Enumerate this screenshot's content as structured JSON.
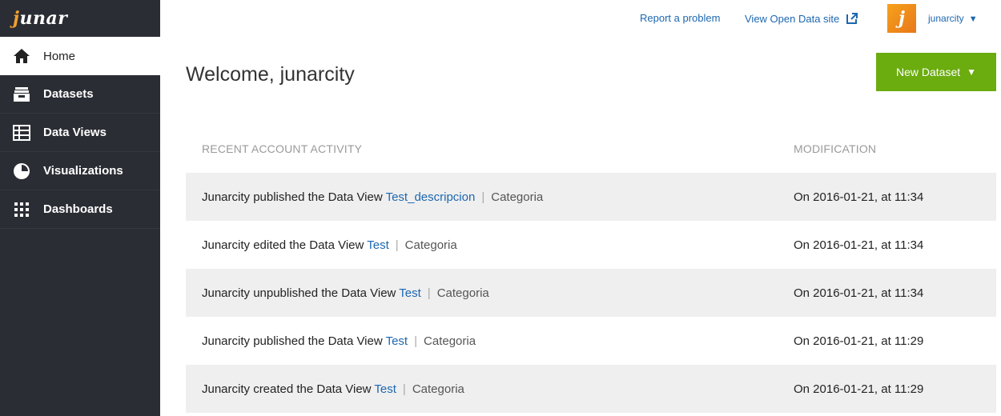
{
  "logo": {
    "text_j": "j",
    "text_rest": "unar"
  },
  "nav": [
    {
      "label": "Home",
      "icon": "home-icon"
    },
    {
      "label": "Datasets",
      "icon": "datasets-icon"
    },
    {
      "label": "Data Views",
      "icon": "data-views-icon"
    },
    {
      "label": "Visualizations",
      "icon": "visualizations-icon"
    },
    {
      "label": "Dashboards",
      "icon": "dashboards-icon"
    }
  ],
  "topbar": {
    "report_problem": "Report a problem",
    "view_site": "View Open Data site",
    "avatar_letter": "j",
    "username": "junarcity",
    "caret": "▼"
  },
  "main": {
    "title": "Welcome, junarcity",
    "new_dataset": "New Dataset",
    "new_dataset_caret": "▼"
  },
  "activity": {
    "header_activity": "RECENT ACCOUNT ACTIVITY",
    "header_modification": "MODIFICATION",
    "separator": "|",
    "rows": [
      {
        "text": "Junarcity published the Data View ",
        "link": "Test_descripcion",
        "category": "Categoria",
        "modified": "On 2016-01-21, at 11:34"
      },
      {
        "text": "Junarcity edited the Data View ",
        "link": "Test",
        "category": "Categoria",
        "modified": "On 2016-01-21, at 11:34"
      },
      {
        "text": "Junarcity unpublished the Data View ",
        "link": "Test",
        "category": "Categoria",
        "modified": "On 2016-01-21, at 11:34"
      },
      {
        "text": "Junarcity published the Data View ",
        "link": "Test",
        "category": "Categoria",
        "modified": "On 2016-01-21, at 11:29"
      },
      {
        "text": "Junarcity created the Data View ",
        "link": "Test",
        "category": "Categoria",
        "modified": "On 2016-01-21, at 11:29"
      }
    ]
  },
  "colors": {
    "sidebar_bg": "#2a2d33",
    "accent_green": "#6bac0f",
    "link_blue": "#1d67b0",
    "avatar_orange": "#f0a030"
  }
}
